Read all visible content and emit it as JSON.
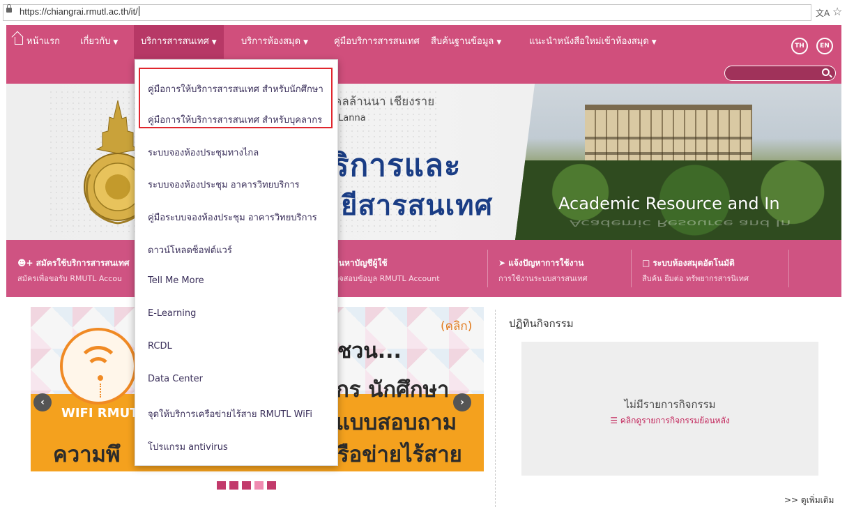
{
  "browser": {
    "url": "https://chiangrai.rmutl.ac.th/it/",
    "translate_icon": "translate-icon",
    "star_icon": "star-icon"
  },
  "nav": {
    "home": "หน้าแรก",
    "items": [
      {
        "label": "เกี่ยวกับ"
      },
      {
        "label": "บริการสารสนเทศ"
      },
      {
        "label": "บริการห้องสมุด"
      },
      {
        "label": "คู่มือบริการสารสนเทศ"
      },
      {
        "label": "สืบค้นฐานข้อมูล"
      },
      {
        "label": "แนะนำหนังสือใหม่เข้าห้องสมุด"
      }
    ],
    "lang_th": "TH",
    "lang_en": "EN",
    "search_placeholder": ""
  },
  "dropdown": {
    "items": [
      "คู่มือการให้บริการสารสนเทศ สำหรับนักศึกษา",
      "คู่มือการให้บริการสารสนเทศ สำหรับบุคลากร",
      "ระบบจองห้องประชุมทางไกล",
      "ระบบจองห้องประชุม อาคารวิทยบริการ",
      "คู่มือระบบจองห้องประชุม อาคารวิทยบริการ",
      "ดาวน์โหลดซ็อฟต์แวร์",
      "Tell Me More",
      "E-Learning",
      "RCDL",
      "Data Center",
      "จุดให้บริการเครือข่ายไร้สาย RMUTL WiFi",
      "โปรแกรม antivirus"
    ],
    "highlight_color": "#e0262d"
  },
  "banner": {
    "univ_th": "คลล้านนา เชียงราย",
    "univ_en": "Lanna",
    "big1": "ริการและ",
    "big2": "ยีสารสนเทศ",
    "academic": "Academic Resource and In"
  },
  "services": [
    {
      "title": "สมัครใช้บริการสารสนเทศ",
      "sub": "สมัครเพื่อขอรับ RMUTL Accou"
    },
    {
      "title": "ค้นหาบัญชีผู้ใช้",
      "sub": "ตรวจสอบข้อมูล RMUTL Account"
    },
    {
      "title": "แจ้งปัญหาการใช้งาน",
      "sub": "การใช้งานระบบสารสนเทศ"
    },
    {
      "title": "ระบบห้องสมุดอัตโนมัติ",
      "sub": "สืบค้น ยืมต่อ ทรัพยากรสารนิเทศ"
    }
  ],
  "slider": {
    "click": "(คลิก)",
    "chuan": "ชวน...",
    "line1": "กร นักศึกษา",
    "line2": "แบบสอบถาม",
    "line3": "รือข่ายไร้สาย",
    "line4": "ความพึ",
    "wifi_text": "WIFI RMUTL",
    "prev": "‹",
    "next": "›"
  },
  "activity": {
    "title": "ปฏิทินกิจกรรม",
    "empty": "ไม่มีรายการกิจกรรม",
    "history": "คลิกดูรายการกิจกรรมย้อนหลัง",
    "see_more": ">> ดูเพิ่มเติม"
  },
  "colors": {
    "nav": "#d04f7c",
    "nav_active": "#b73866",
    "service_bar": "#cf5382"
  }
}
